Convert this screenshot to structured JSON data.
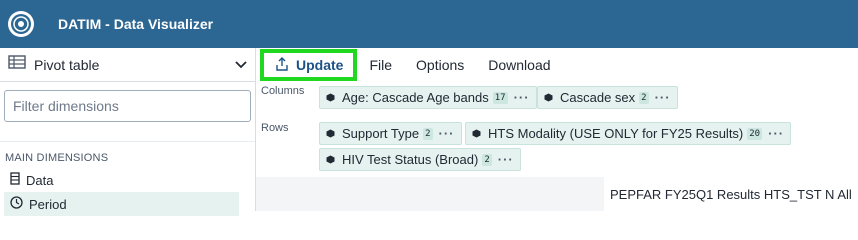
{
  "app": {
    "title": "DATIM - Data Visualizer"
  },
  "toolbar": {
    "vis_type": "Pivot table",
    "update": "Update",
    "file": "File",
    "options": "Options",
    "download": "Download"
  },
  "left": {
    "filter_placeholder": "Filter dimensions",
    "section": "MAIN DIMENSIONS",
    "items": [
      {
        "label": "Data",
        "icon": "database-icon"
      },
      {
        "label": "Period",
        "icon": "clock-icon"
      }
    ]
  },
  "layout": {
    "columns_label": "Columns",
    "rows_label": "Rows",
    "columns": [
      {
        "label": "Age: Cascade Age bands",
        "count": "17"
      },
      {
        "label": "Cascade sex",
        "count": "2"
      }
    ],
    "rows": [
      {
        "label": "Support Type",
        "count": "2"
      },
      {
        "label": "HTS Modality (USE ONLY for FY25 Results)",
        "count": "20"
      },
      {
        "label": "HIV Test Status (Broad)",
        "count": "2"
      }
    ]
  },
  "visual": {
    "title": "PEPFAR FY25Q1 Results HTS_TST N All"
  }
}
